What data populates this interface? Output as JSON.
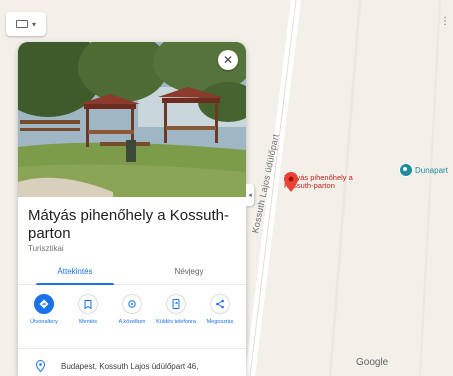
{
  "map": {
    "road_label": "Kossuth Lajos üdülőpart",
    "place_pin_label": "Mátyás pihenőhely a Kossuth-parton",
    "poi_label": "Dunapart",
    "google_logo": "Google",
    "layers_caret": "▾",
    "apps_glyph": "⋮⋮⋮"
  },
  "panel": {
    "title": "Mátyás pihenőhely a Kossuth-parton",
    "subtitle": "Turisztikai",
    "close_glyph": "✕",
    "collapse_glyph": "◂",
    "tabs": [
      {
        "label": "Áttekintés",
        "active": true
      },
      {
        "label": "Névjegy",
        "active": false
      }
    ],
    "actions": [
      {
        "label": "Útvonaltery",
        "icon": "directions-icon"
      },
      {
        "label": "Mentés",
        "icon": "bookmark-icon"
      },
      {
        "label": "A közelben",
        "icon": "nearby-icon"
      },
      {
        "label": "Küldés telefonra",
        "icon": "send-to-phone-icon"
      },
      {
        "label": "Megosztás",
        "icon": "share-icon"
      }
    ],
    "address": "Budapest, Kossuth Lajos üdülőpart 46,"
  },
  "colors": {
    "accent": "#1a73e8",
    "pin": "#ea4335",
    "poi": "#1e8e9e"
  }
}
